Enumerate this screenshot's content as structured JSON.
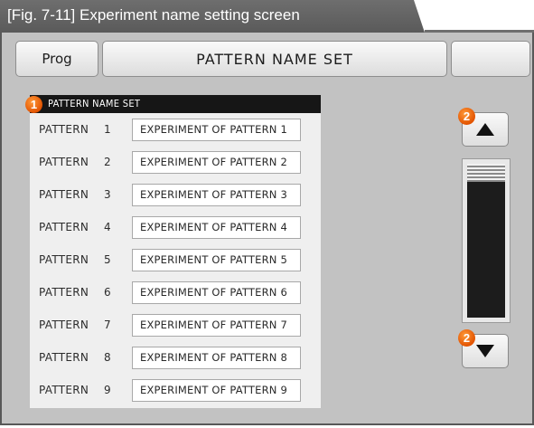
{
  "figure": {
    "caption": "[Fig. 7-11] Experiment name setting screen"
  },
  "header": {
    "prog_label": "Prog",
    "title": "PATTERN NAME SET",
    "blank_label": ""
  },
  "markers": {
    "panel": "1",
    "scroll_up": "2",
    "scroll_down": "2",
    "color": "#e85c0c"
  },
  "panel": {
    "title": "PATTERN NAME SET",
    "rows": [
      {
        "label": "PATTERN",
        "num": "1",
        "name": "EXPERIMENT OF PATTERN 1"
      },
      {
        "label": "PATTERN",
        "num": "2",
        "name": "EXPERIMENT OF PATTERN 2"
      },
      {
        "label": "PATTERN",
        "num": "3",
        "name": "EXPERIMENT OF PATTERN 3"
      },
      {
        "label": "PATTERN",
        "num": "4",
        "name": "EXPERIMENT OF PATTERN 4"
      },
      {
        "label": "PATTERN",
        "num": "5",
        "name": "EXPERIMENT OF PATTERN 5"
      },
      {
        "label": "PATTERN",
        "num": "6",
        "name": "EXPERIMENT OF PATTERN 6"
      },
      {
        "label": "PATTERN",
        "num": "7",
        "name": "EXPERIMENT OF PATTERN 7"
      },
      {
        "label": "PATTERN",
        "num": "8",
        "name": "EXPERIMENT OF PATTERN 8"
      },
      {
        "label": "PATTERN",
        "num": "9",
        "name": "EXPERIMENT OF PATTERN 9"
      }
    ]
  },
  "scroll": {
    "up_icon": "triangle-up-icon",
    "down_icon": "triangle-down-icon",
    "position": 0
  },
  "colors": {
    "screen_bg": "#c2c2c2",
    "panel_header_bg": "#161616",
    "field_bg": "#ffffff"
  }
}
